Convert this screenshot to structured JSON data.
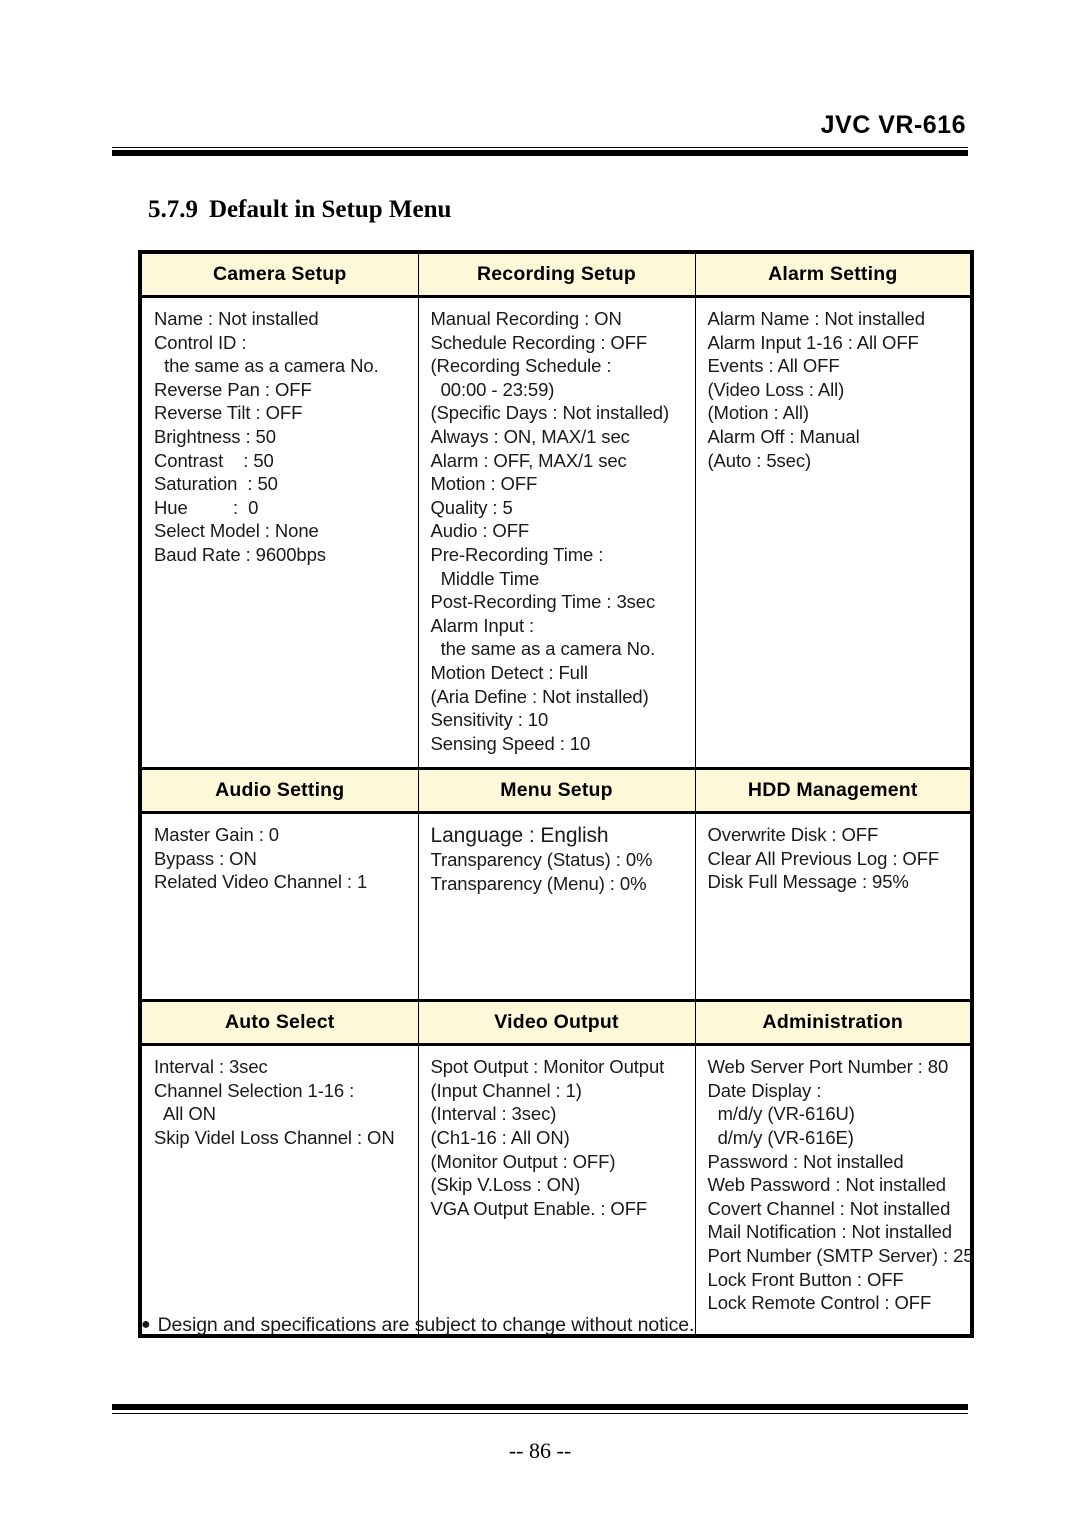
{
  "header": {
    "title": "JVC VR-616"
  },
  "section": {
    "number": "5.7.9",
    "title": "Default in Setup Menu"
  },
  "colors": {
    "header_cell_background": "#FDF8D7",
    "text": "#1A1A1A",
    "rule": "#000000"
  },
  "table": {
    "rows": [
      {
        "headers": [
          "Camera Setup",
          "Recording Setup",
          "Alarm Setting"
        ],
        "cells": [
          [
            "Name : Not installed",
            "Control ID :",
            "  the same as a camera No.",
            "Reverse Pan : OFF",
            "Reverse Tilt : OFF",
            "Brightness : 50",
            "Contrast    : 50",
            "Saturation  : 50",
            "Hue         :  0",
            "Select Model : None",
            "Baud Rate : 9600bps"
          ],
          [
            "Manual Recording : ON",
            "Schedule Recording : OFF",
            "(Recording Schedule :",
            "  00:00 - 23:59)",
            "(Specific Days : Not installed)",
            "Always : ON, MAX/1 sec",
            "Alarm : OFF, MAX/1 sec",
            "Motion : OFF",
            "Quality : 5",
            "Audio : OFF",
            "Pre-Recording Time :",
            "  Middle Time",
            "Post-Recording Time : 3sec",
            "Alarm Input :",
            "  the same as a camera No.",
            "Motion Detect : Full",
            "(Aria Define : Not installed)",
            "Sensitivity : 10",
            "Sensing Speed : 10"
          ],
          [
            "Alarm Name : Not installed",
            "Alarm Input 1-16 : All OFF",
            "Events : All OFF",
            "(Video Loss : All)",
            "(Motion : All)",
            "Alarm Off : Manual",
            "(Auto : 5sec)"
          ]
        ]
      },
      {
        "headers": [
          "Audio Setting",
          "Menu Setup",
          "HDD Management"
        ],
        "cells": [
          [
            "Master Gain : 0",
            "Bypass : ON",
            "Related Video Channel : 1"
          ],
          [
            "Language : English",
            "Transparency (Status) : 0%",
            "Transparency (Menu) : 0%"
          ],
          [
            "Overwrite Disk : OFF",
            "Clear All Previous Log : OFF",
            "Disk Full Message : 95%"
          ]
        ],
        "emphasis": {
          "col": 1,
          "line": 0
        }
      },
      {
        "headers": [
          "Auto Select",
          "Video Output",
          "Administration"
        ],
        "cells": [
          [
            "Interval : 3sec",
            "Channel Selection 1-16 :",
            "  All ON",
            "Skip Videl Loss Channel : ON"
          ],
          [
            "Spot Output : Monitor Output",
            "(Input Channel : 1)",
            "(Interval : 3sec)",
            "(Ch1-16 : All ON)",
            "(Monitor Output : OFF)",
            "(Skip V.Loss : ON)",
            "VGA Output Enable. : OFF"
          ],
          [
            "Web Server Port Number : 80",
            "Date Display :",
            "  m/d/y (VR-616U)",
            "  d/m/y (VR-616E)",
            "Password : Not installed",
            "Web Password : Not installed",
            "Covert Channel : Not installed",
            "Mail Notification : Not installed",
            "Port Number (SMTP Server) : 25",
            "Lock Front Button : OFF",
            "Lock Remote Control : OFF"
          ]
        ]
      }
    ]
  },
  "footnote": {
    "bullet": "●",
    "text": "Design and specifications are subject to change without notice."
  },
  "footer": {
    "page_number": "-- 86 --"
  }
}
